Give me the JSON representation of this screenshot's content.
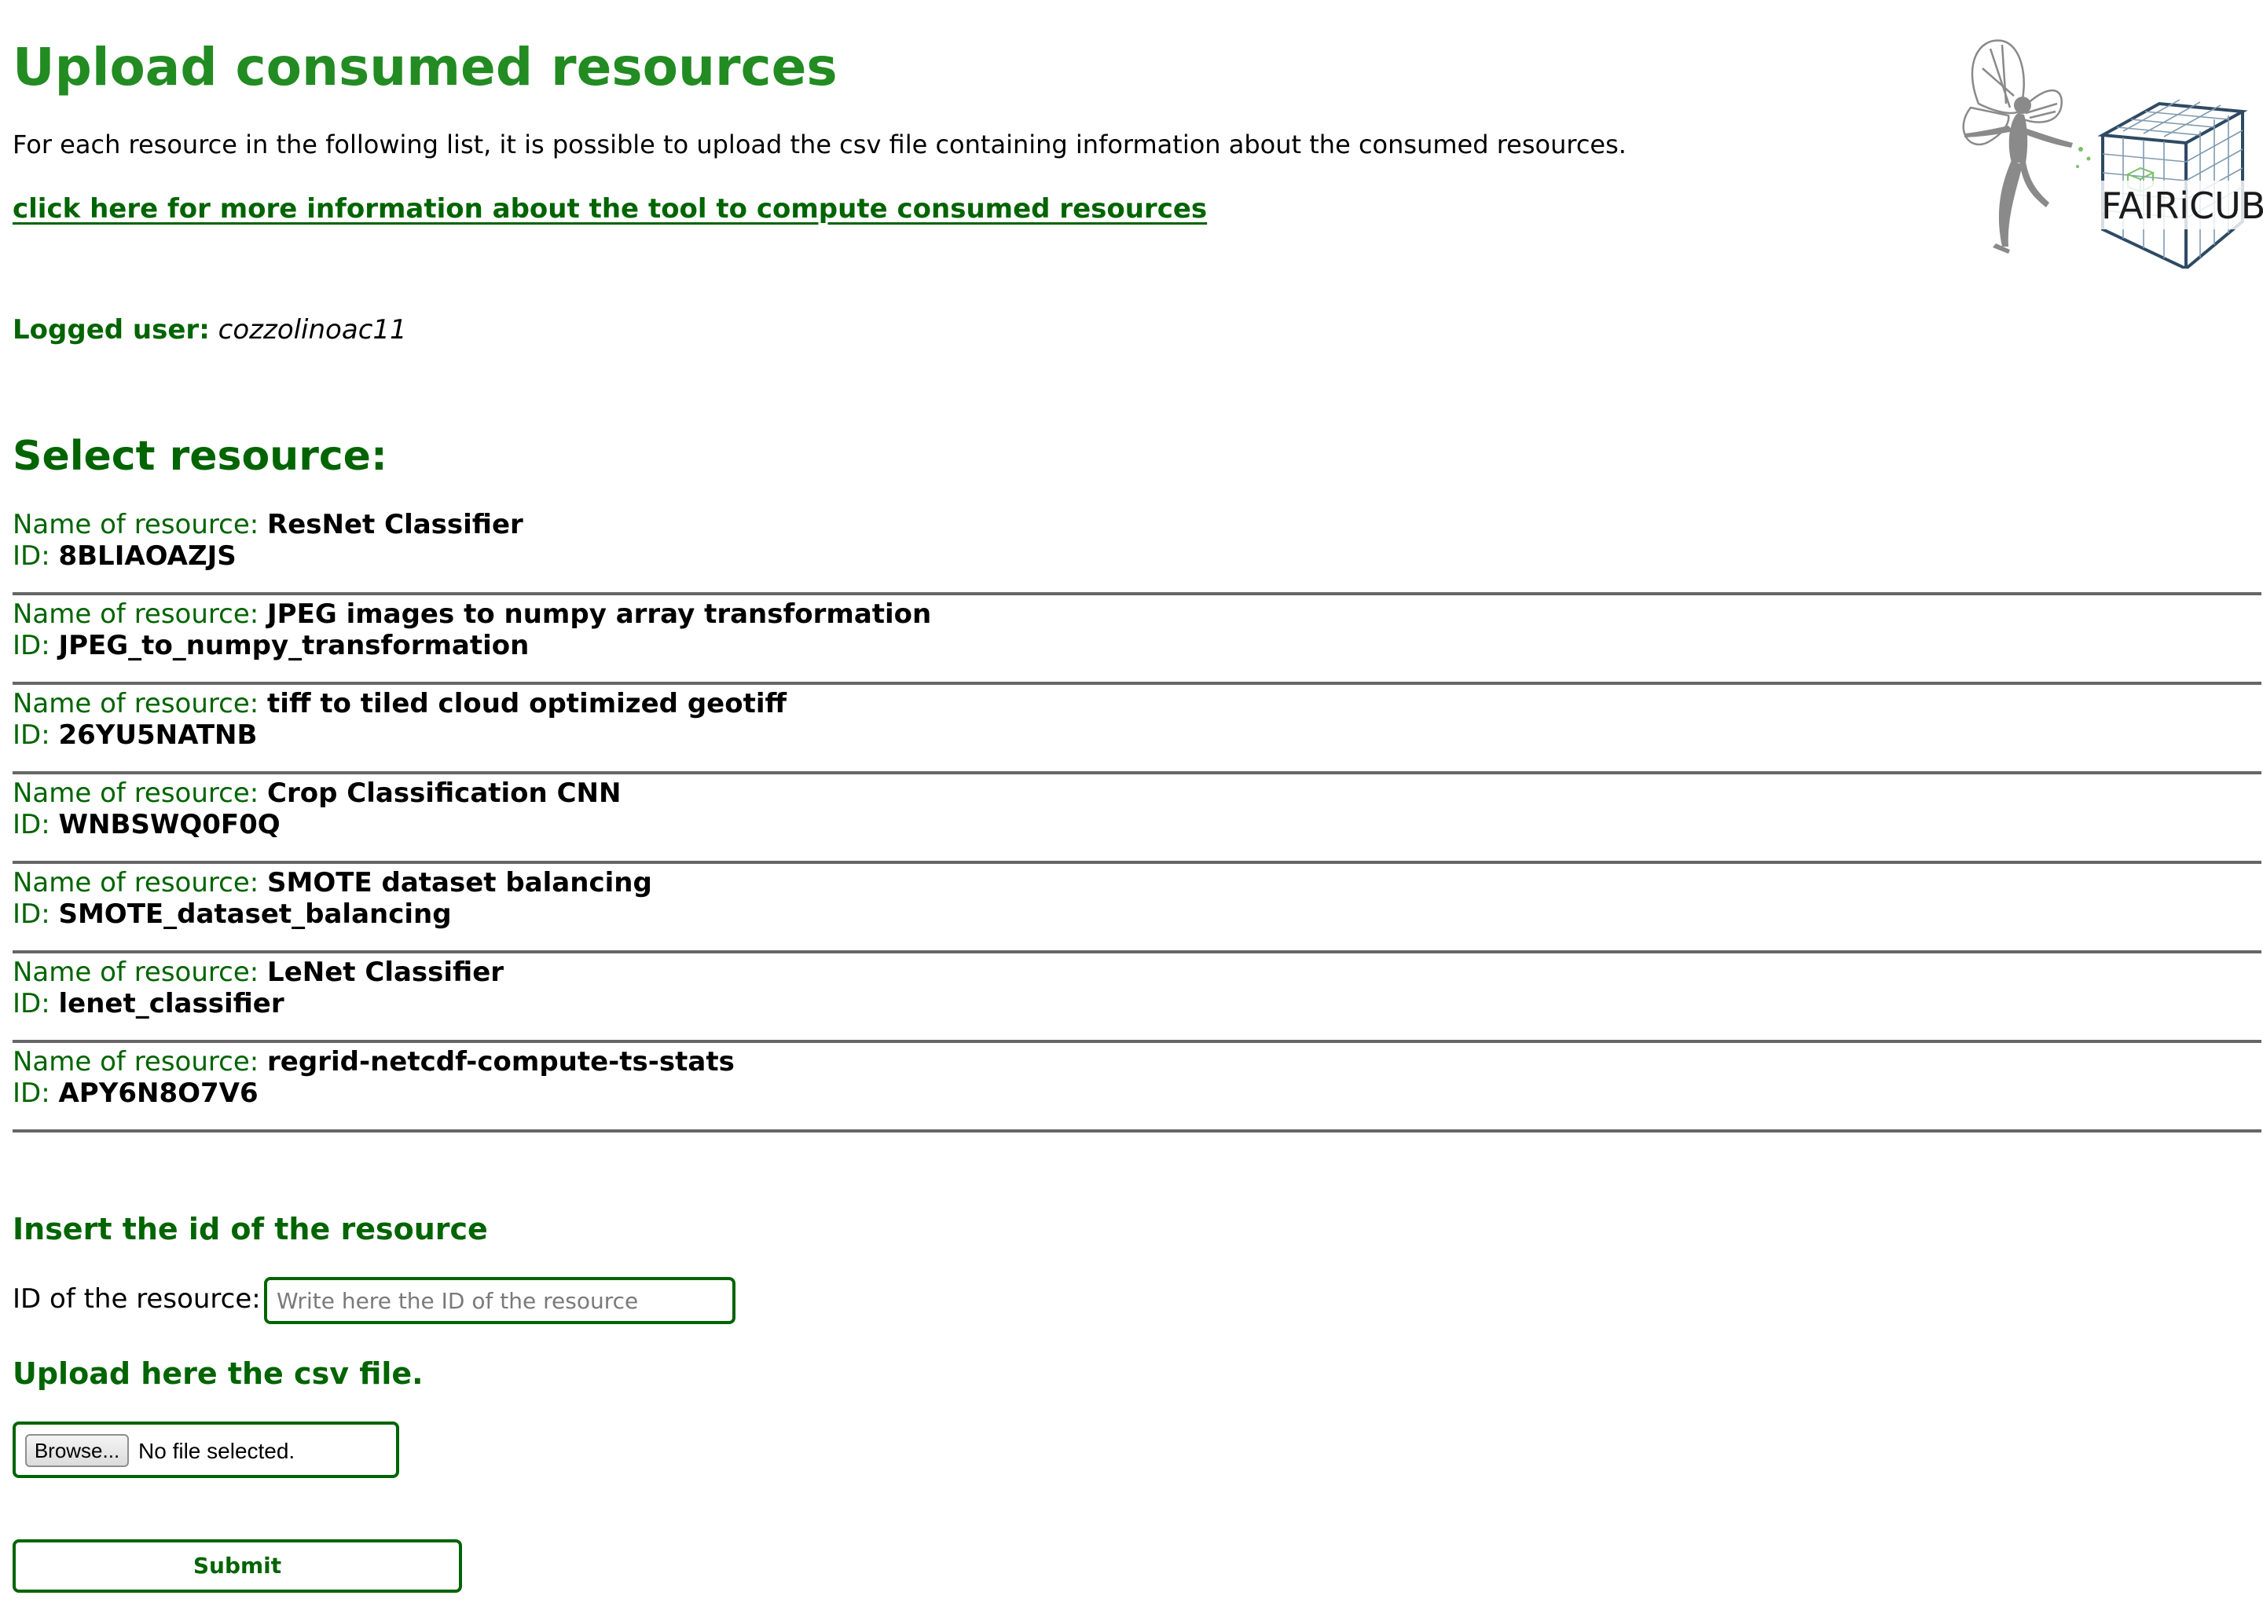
{
  "page": {
    "title": "Upload consumed resources",
    "intro": "For each resource in the following list, it is possible to upload the csv file containing information about the consumed resources.",
    "info_link": "click here for more information about the tool to compute consumed resources"
  },
  "logo": {
    "text": "FAIRiCUBE",
    "icon": "fairy-cube-logo",
    "colors": {
      "fairy": "#8a8a8a",
      "cube": "#2e4a63",
      "grid": "#7f9bb0",
      "accent": "#7bbf6a"
    }
  },
  "user": {
    "label": "Logged user:",
    "name": "cozzolinoac11"
  },
  "select": {
    "title": "Select resource:",
    "name_label": "Name of resource:",
    "id_label": "ID:",
    "resources": [
      {
        "name": "ResNet Classifier",
        "id": "8BLIAOAZJS"
      },
      {
        "name": "JPEG images to numpy array transformation",
        "id": "JPEG_to_numpy_transformation"
      },
      {
        "name": "tiff to tiled cloud optimized geotiff",
        "id": "26YU5NATNB"
      },
      {
        "name": "Crop Classification CNN",
        "id": "WNBSWQ0F0Q"
      },
      {
        "name": "SMOTE dataset balancing",
        "id": "SMOTE_dataset_balancing"
      },
      {
        "name": "LeNet Classifier",
        "id": "lenet_classifier"
      },
      {
        "name": "regrid-netcdf-compute-ts-stats",
        "id": "APY6N8O7V6"
      }
    ]
  },
  "form": {
    "insert_title": "Insert the id of the resource",
    "id_field_label": "ID of the resource:",
    "id_placeholder": "Write here the ID of the resource",
    "id_value": "",
    "upload_title": "Upload here the csv file.",
    "browse_label": "Browse...",
    "file_status": "No file selected.",
    "submit_label": "Submit"
  },
  "colors": {
    "title_green": "#228b22",
    "dark_green": "#006400",
    "divider": "#666666"
  }
}
